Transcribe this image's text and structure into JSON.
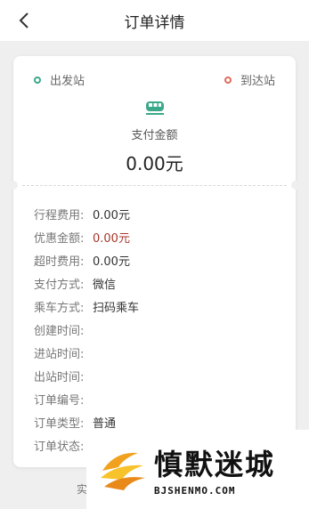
{
  "header": {
    "title": "订单详情",
    "back_icon": "chevron-left-icon"
  },
  "route": {
    "start_label": "出发站",
    "end_label": "到达站",
    "start_dot_color": "#3ba88a",
    "end_dot_color": "#e06b5e"
  },
  "payment": {
    "icon": "train-icon",
    "label": "支付金额",
    "amount": "0.00元"
  },
  "details": [
    {
      "key": "行程费用:",
      "value": "0.00元",
      "highlight": false
    },
    {
      "key": "优惠金额:",
      "value": "0.00元",
      "highlight": true
    },
    {
      "key": "超时费用:",
      "value": "0.00元",
      "highlight": false
    },
    {
      "key": "支付方式:",
      "value": "微信",
      "highlight": false
    },
    {
      "key": "乘车方式:",
      "value": "扫码乘车",
      "highlight": false
    },
    {
      "key": "创建时间:",
      "value": "",
      "highlight": false
    },
    {
      "key": "进站时间:",
      "value": "",
      "highlight": false
    },
    {
      "key": "出站时间:",
      "value": "",
      "highlight": false
    },
    {
      "key": "订单编号:",
      "value": "",
      "highlight": false
    },
    {
      "key": "订单类型:",
      "value": "普通",
      "highlight": false
    },
    {
      "key": "订单状态:",
      "value": "",
      "highlight": false
    }
  ],
  "bottom_text": "实",
  "watermark": {
    "title": "慎默迷城",
    "subtitle": "BJSHENMO.COM"
  },
  "colors": {
    "accent_green": "#3ba88a",
    "discount_red": "#a8372c"
  }
}
